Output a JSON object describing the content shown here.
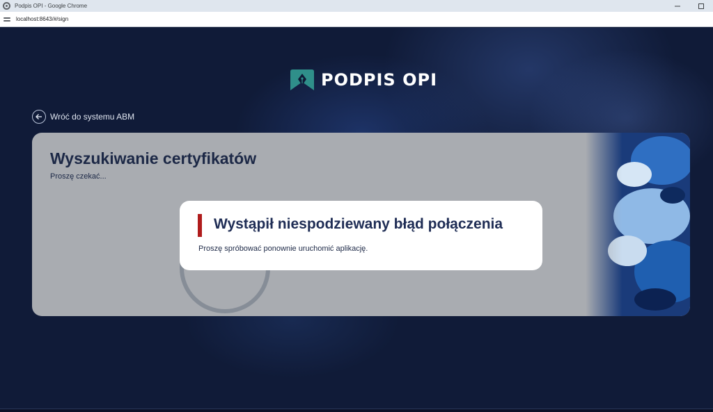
{
  "browser": {
    "window_title": "Podpis OPI - Google Chrome",
    "url": "localhost:8643/#/sign",
    "minimize_icon": "minimize-icon",
    "maximize_icon": "maximize-icon"
  },
  "logo": {
    "text": "PODPIS OPI",
    "icon": "pen-nib-icon",
    "mark_color": "#2f8f8a"
  },
  "back_link": {
    "label": "Wróć do systemu ABM",
    "icon": "arrow-left-icon"
  },
  "card": {
    "title": "Wyszukiwanie certyfikatów",
    "subtitle": "Proszę czekać..."
  },
  "dialog": {
    "title": "Wystąpił niespodziewany błąd połączenia",
    "message": "Proszę spróbować ponownie uruchomić aplikację.",
    "accent_color": "#b01c1c"
  }
}
